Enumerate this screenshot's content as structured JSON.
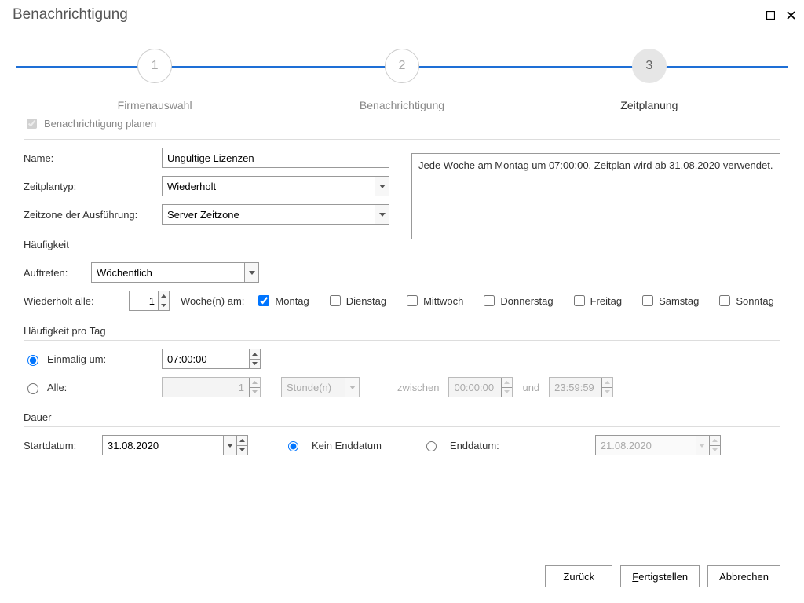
{
  "title": "Benachrichtigung",
  "steps": {
    "s1": {
      "num": "1",
      "label": "Firmenauswahl"
    },
    "s2": {
      "num": "2",
      "label": "Benachrichtigung"
    },
    "s3": {
      "num": "3",
      "label": "Zeitplanung"
    }
  },
  "plan_checkbox_label": "Benachrichtigung planen",
  "labels": {
    "name": "Name:",
    "schedule_type": "Zeitplantyp:",
    "timezone": "Zeitzone der Ausführung:",
    "frequency_head": "Häufigkeit",
    "occurrence": "Auftreten:",
    "repeat_every": "Wiederholt alle:",
    "weeks_on": "Woche(n) am:",
    "daily_head": "Häufigkeit pro Tag",
    "once_at": "Einmalig um:",
    "every": "Alle:",
    "unit": "Stunde(n)",
    "between": "zwischen",
    "and": "und",
    "duration_head": "Dauer",
    "start_date": "Startdatum:",
    "no_end": "Kein Enddatum",
    "end_date": "Enddatum:"
  },
  "values": {
    "name": "Ungültige Lizenzen",
    "schedule_type": "Wiederholt",
    "timezone": "Server Zeitzone",
    "occurrence": "Wöchentlich",
    "repeat_count": "1",
    "once_time": "07:00:00",
    "every_count": "1",
    "between_from": "00:00:00",
    "between_to": "23:59:59",
    "start_date": "31.08.2020",
    "end_date": "21.08.2020"
  },
  "days": {
    "mon": "Montag",
    "tue": "Dienstag",
    "wed": "Mittwoch",
    "thu": "Donnerstag",
    "fri": "Freitag",
    "sat": "Samstag",
    "sun": "Sonntag"
  },
  "summary": "Jede Woche am Montag um 07:00:00. Zeitplan wird ab 31.08.2020 verwendet.",
  "buttons": {
    "back": "Zurück",
    "finish_u": "F",
    "finish_rest": "ertigstellen",
    "cancel": "Abbrechen"
  }
}
